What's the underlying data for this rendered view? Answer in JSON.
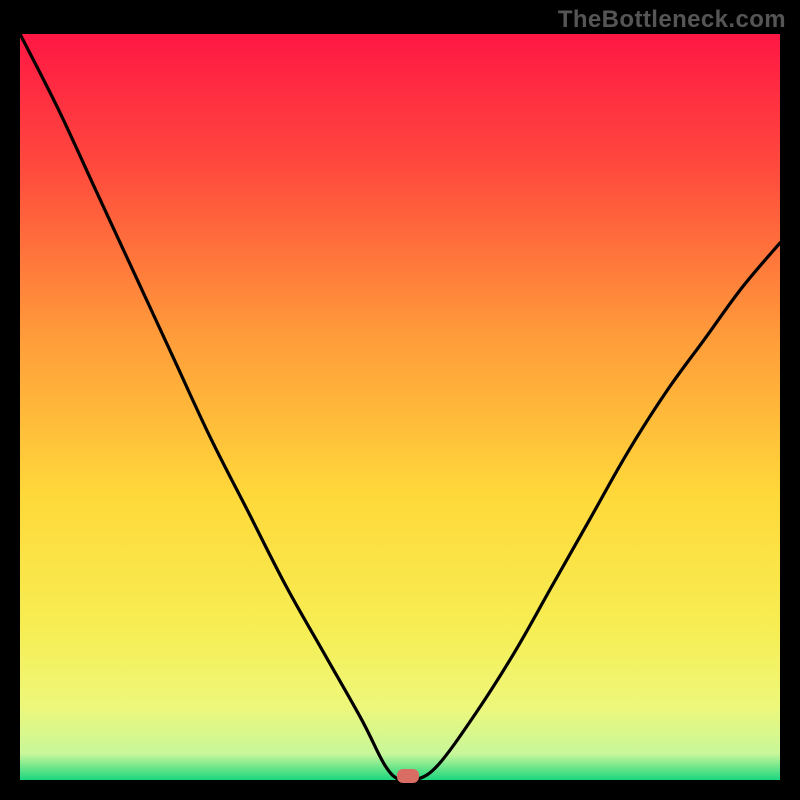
{
  "watermark": "TheBottleneck.com",
  "chart_data": {
    "type": "line",
    "title": "",
    "xlabel": "",
    "ylabel": "",
    "xlim": [
      0,
      100
    ],
    "ylim": [
      0,
      100
    ],
    "grid": false,
    "legend": false,
    "series": [
      {
        "name": "bottleneck-curve",
        "x": [
          0,
          5,
          10,
          15,
          20,
          25,
          30,
          35,
          40,
          45,
          48,
          50,
          52,
          55,
          60,
          65,
          70,
          75,
          80,
          85,
          90,
          95,
          100
        ],
        "y": [
          100,
          90,
          79,
          68,
          57,
          46,
          36,
          26,
          17,
          8,
          2,
          0,
          0,
          2,
          9,
          17,
          26,
          35,
          44,
          52,
          59,
          66,
          72
        ]
      }
    ],
    "marker": {
      "x": 51,
      "y": 0,
      "color": "#d96c63"
    },
    "background_gradient": {
      "type": "vertical",
      "stops": [
        {
          "pos": 0.0,
          "color": "#ff1744"
        },
        {
          "pos": 0.18,
          "color": "#ff4a3d"
        },
        {
          "pos": 0.4,
          "color": "#ff9a3a"
        },
        {
          "pos": 0.62,
          "color": "#ffd93a"
        },
        {
          "pos": 0.8,
          "color": "#f6ee54"
        },
        {
          "pos": 0.9,
          "color": "#eef77a"
        },
        {
          "pos": 0.965,
          "color": "#c8f79a"
        },
        {
          "pos": 1.0,
          "color": "#1ad67e"
        }
      ]
    }
  }
}
